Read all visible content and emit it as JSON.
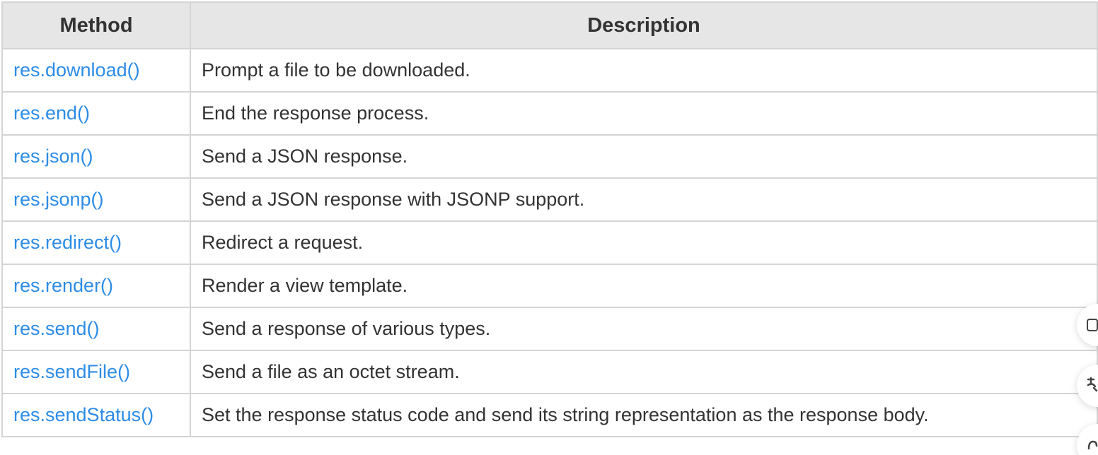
{
  "table": {
    "headers": {
      "method": "Method",
      "description": "Description"
    },
    "rows": [
      {
        "method": "res.download()",
        "description": "Prompt a file to be downloaded."
      },
      {
        "method": "res.end()",
        "description": "End the response process."
      },
      {
        "method": "res.json()",
        "description": "Send a JSON response."
      },
      {
        "method": "res.jsonp()",
        "description": "Send a JSON response with JSONP support."
      },
      {
        "method": "res.redirect()",
        "description": "Redirect a request."
      },
      {
        "method": "res.render()",
        "description": "Render a view template."
      },
      {
        "method": "res.send()",
        "description": "Send a response of various types."
      },
      {
        "method": "res.sendFile()",
        "description": "Send a file as an octet stream."
      },
      {
        "method": "res.sendStatus()",
        "description": "Set the response status code and send its string representation as the response body."
      }
    ]
  },
  "floating_buttons": [
    {
      "icon": "copy-icon"
    },
    {
      "icon": "translate-icon"
    },
    {
      "icon": "more-icon"
    }
  ],
  "colors": {
    "link": "#2d8ce6",
    "header_bg": "#e6e6e6",
    "border": "#d4d4d4",
    "text": "#333333"
  }
}
